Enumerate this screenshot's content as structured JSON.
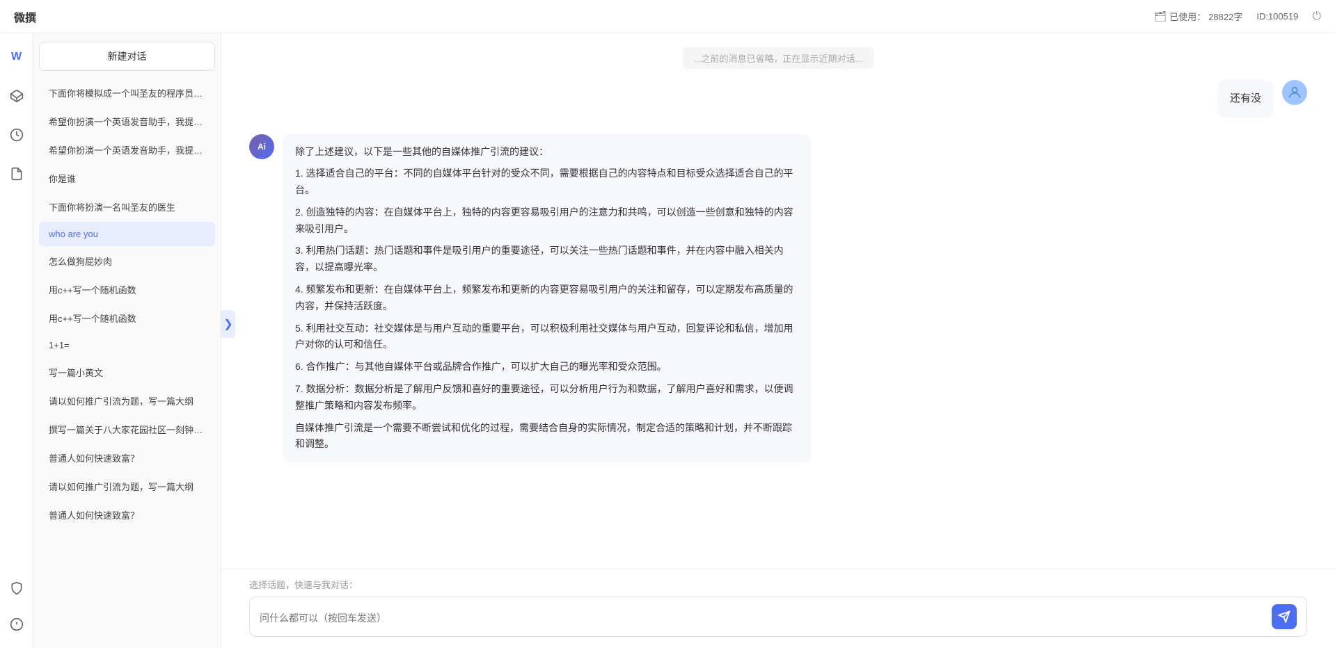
{
  "topbar": {
    "title": "微撰",
    "usage_label": "已使用：",
    "usage_count": "28822字",
    "id_label": "ID:100519",
    "storage_icon": "database-icon",
    "power_icon": "power-icon"
  },
  "icon_nav": {
    "items": [
      {
        "id": "home",
        "icon": "W",
        "label": "home-icon",
        "active": false
      },
      {
        "id": "box",
        "icon": "⬡",
        "label": "box-icon",
        "active": false
      },
      {
        "id": "clock",
        "icon": "⏰",
        "label": "clock-icon",
        "active": false
      },
      {
        "id": "doc",
        "icon": "📄",
        "label": "doc-icon",
        "active": false
      }
    ],
    "bottom_items": [
      {
        "id": "shield",
        "icon": "🛡",
        "label": "shield-icon"
      },
      {
        "id": "info",
        "icon": "ℹ",
        "label": "info-icon"
      }
    ]
  },
  "sidebar": {
    "new_btn": "新建对话",
    "items": [
      {
        "id": 1,
        "text": "下面你将模拟成一个叫圣友的程序员，我说...",
        "active": false
      },
      {
        "id": 2,
        "text": "希望你扮演一个英语发音助手，我提供给你...",
        "active": false
      },
      {
        "id": 3,
        "text": "希望你扮演一个英语发音助手，我提供给你...",
        "active": false
      },
      {
        "id": 4,
        "text": "你是谁",
        "active": false
      },
      {
        "id": 5,
        "text": "下面你将扮演一名叫圣友的医生",
        "active": false
      },
      {
        "id": 6,
        "text": "who are you",
        "active": true
      },
      {
        "id": 7,
        "text": "怎么做狗屁妙肉",
        "active": false
      },
      {
        "id": 8,
        "text": "用c++写一个随机函数",
        "active": false
      },
      {
        "id": 9,
        "text": "用c++写一个随机函数",
        "active": false
      },
      {
        "id": 10,
        "text": "1+1=",
        "active": false
      },
      {
        "id": 11,
        "text": "写一篇小黄文",
        "active": false
      },
      {
        "id": 12,
        "text": "请以如何推广引流为题，写一篇大纲",
        "active": false
      },
      {
        "id": 13,
        "text": "撰写一篇关于八大家花园社区一刻钟便民生...",
        "active": false
      },
      {
        "id": 14,
        "text": "普通人如何快速致富？",
        "active": false
      },
      {
        "id": 15,
        "text": "请以如何推广引流为题，写一篇大纲",
        "active": false
      },
      {
        "id": 16,
        "text": "普通人如何快速致富？",
        "active": false
      }
    ]
  },
  "chat": {
    "truncated_top": "...之前消息内容已省略，正在显示近期对话内容...",
    "messages": [
      {
        "id": 1,
        "role": "user",
        "text": "还有没",
        "avatar_type": "user"
      },
      {
        "id": 2,
        "role": "ai",
        "text": "除了上述建议，以下是一些其他的自媒体推广引流的建议：\n\n1. 选择适合自己的平台：不同的自媒体平台针对的受众不同，需要根据自己的内容特点和目标受众选择适合自己的平台。\n\n2. 创造独特的内容：在自媒体平台上，独特的内容更容易吸引用户的注意力和共鸣，可以创造一些创意和独特的内容来吸引用户。\n\n3. 利用热门话题：热门话题和事件是吸引用户的重要途径，可以关注一些热门话题和事件，并在内容中融入相关内容，以提高曝光率。\n\n4. 频繁发布和更新：在自媒体平台上，频繁发布和更新的内容更容易吸引用户的关注和留存，可以定期发布高质量的内容，并保持活跃度。\n\n5. 利用社交互动：社交媒体是与用户互动的重要平台，可以积极利用社交媒体与用户互动，回复评论和私信，增加用户对你的认可和信任。\n\n6. 合作推广：与其他自媒体平台或品牌合作推广，可以扩大自己的曝光率和受众范围。\n\n7. 数据分析：数据分析是了解用户反馈和喜好的重要途径，可以分析用户行为和数据，了解用户喜好和需求，以便调整推广策略和内容发布频率。\n\n自媒体推广引流是一个需要不断尝试和优化的过程，需要结合自身的实际情况，制定合适的策略和计划，并不断跟踪和调整。",
        "avatar_type": "ai"
      }
    ],
    "quick_select_label": "选择话题，快速与我对话：",
    "input_placeholder": "问什么都可以（按回车发送）"
  }
}
